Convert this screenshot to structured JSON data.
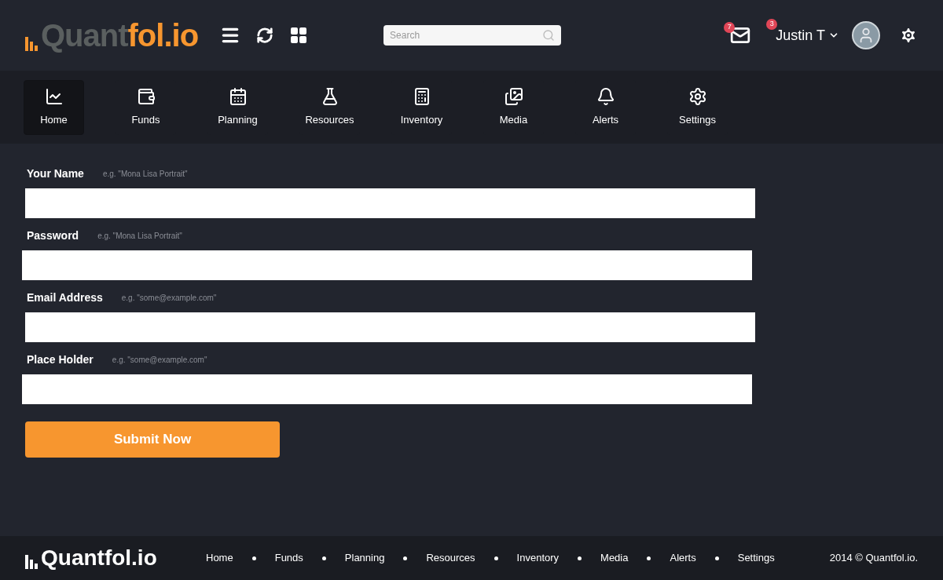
{
  "header": {
    "logo": {
      "part_1": "Quant",
      "part_2": "fol.io"
    },
    "search": {
      "placeholder": "Search"
    },
    "mail_badge": "7",
    "user": {
      "name": "Justin T",
      "badge": "3"
    }
  },
  "nav": [
    {
      "label": "Home",
      "selected": true
    },
    {
      "label": "Funds",
      "selected": false
    },
    {
      "label": "Planning",
      "selected": false
    },
    {
      "label": "Resources",
      "selected": false
    },
    {
      "label": "Inventory",
      "selected": false
    },
    {
      "label": "Media",
      "selected": false
    },
    {
      "label": "Alerts",
      "selected": false
    },
    {
      "label": "Settings",
      "selected": false
    }
  ],
  "form": {
    "fields": [
      {
        "label": "Your Name",
        "hint": "e.g. \"Mona Lisa Portrait\""
      },
      {
        "label": "Password",
        "hint": "e.g. \"Mona Lisa Portrait\""
      },
      {
        "label": "Email Address",
        "hint": "e.g. \"some@example.com\""
      },
      {
        "label": "Place Holder",
        "hint": "e.g. \"some@example.com\""
      }
    ],
    "submit": "Submit Now"
  },
  "footer": {
    "logo": "Quantfol.io",
    "links": [
      "Home",
      "Funds",
      "Planning",
      "Resources",
      "Inventory",
      "Media",
      "Alerts",
      "Settings"
    ],
    "copyright": "2014 © Quantfol.io."
  }
}
